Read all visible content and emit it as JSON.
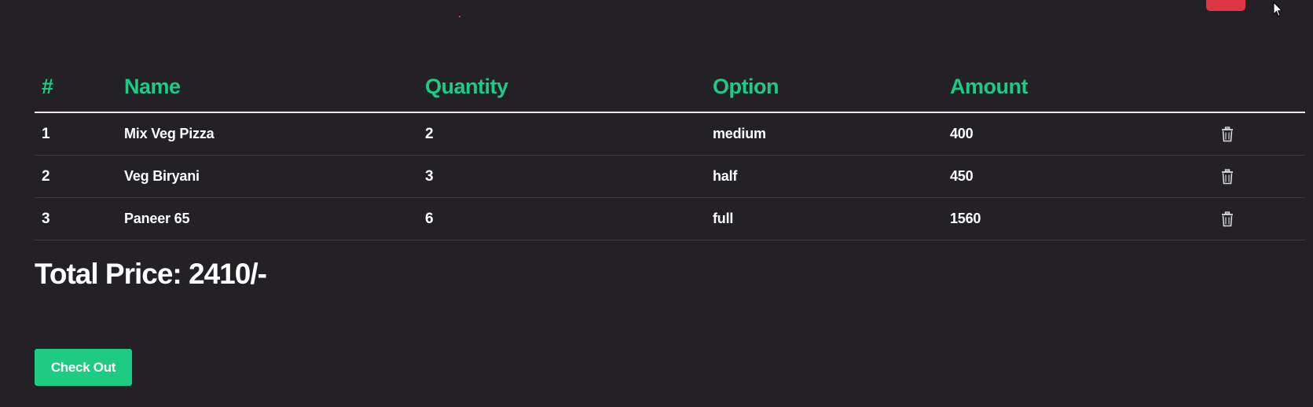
{
  "table": {
    "headers": [
      "#",
      "Name",
      "Quantity",
      "Option",
      "Amount",
      ""
    ],
    "rows": [
      {
        "index": "1",
        "name": "Mix Veg Pizza",
        "quantity": "2",
        "option": "medium",
        "amount": "400"
      },
      {
        "index": "2",
        "name": "Veg Biryani",
        "quantity": "3",
        "option": "half",
        "amount": "450"
      },
      {
        "index": "3",
        "name": "Paneer 65",
        "quantity": "6",
        "option": "full",
        "amount": "1560"
      }
    ]
  },
  "total": {
    "text": "Total Price: 2410/-"
  },
  "checkout": {
    "label": "Check Out"
  },
  "colors": {
    "background": "#232125",
    "accent": "#1ecb83",
    "danger": "#dc3545"
  },
  "icons": {
    "delete": "trash-icon"
  }
}
